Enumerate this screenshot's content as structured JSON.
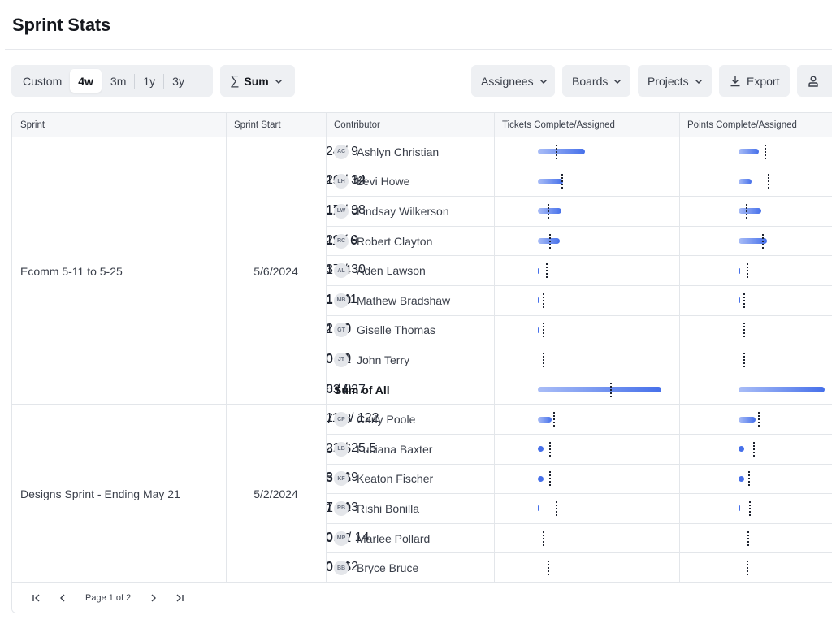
{
  "page": {
    "title": "Sprint Stats"
  },
  "toolbar": {
    "ranges": [
      {
        "label": "Custom",
        "active": false
      },
      {
        "label": "4w",
        "active": true
      },
      {
        "label": "3m",
        "active": false
      },
      {
        "label": "1y",
        "active": false
      },
      {
        "label": "3y",
        "active": false
      }
    ],
    "aggregate": {
      "symbol": "∑",
      "label": "Sum"
    },
    "filters": {
      "assignees": "Assignees",
      "boards": "Boards",
      "projects": "Projects"
    },
    "export_label": "Export"
  },
  "table": {
    "headers": {
      "sprint": "Sprint",
      "sprint_start": "Sprint Start",
      "contributor": "Contributor",
      "tickets": "Tickets Complete/Assigned",
      "points": "Points Complete/Assigned"
    },
    "groups": [
      {
        "sprint": "Ecomm 5-11 to 5-25",
        "start": "5/6/2024",
        "rows": [
          {
            "initials": "AC",
            "name": "Ashlyn Christian",
            "tickets": "24 / 9",
            "t_done": 24,
            "t_assigned": 9,
            "points": "26 / 34",
            "p_done": 26,
            "p_assigned": 34
          },
          {
            "initials": "LH",
            "name": "Levi Howe",
            "tickets": "13 / 12",
            "t_done": 13,
            "t_assigned": 12,
            "points": "17 / 38",
            "p_done": 17,
            "p_assigned": 38
          },
          {
            "initials": "LW",
            "name": "Lindsay Wilkerson",
            "tickets": "12 / 5",
            "t_done": 12,
            "t_assigned": 5,
            "points": "29 / 9",
            "p_done": 29,
            "p_assigned": 9
          },
          {
            "initials": "RC",
            "name": "Robert Clayton",
            "tickets": "11 / 6",
            "t_done": 11,
            "t_assigned": 6,
            "points": "37 / 30",
            "p_done": 37,
            "p_assigned": 30
          },
          {
            "initials": "AL",
            "name": "Aden Lawson",
            "tickets": "1 / 4",
            "t_done": 1,
            "t_assigned": 4,
            "points": "1 / 11",
            "p_done": 1,
            "p_assigned": 11
          },
          {
            "initials": "MB",
            "name": "Mathew Bradshaw",
            "tickets": "1 / 0",
            "t_done": 1,
            "t_assigned": 0,
            "points": "2 / 0",
            "p_done": 2,
            "p_assigned": 0
          },
          {
            "initials": "GT",
            "name": "Giselle Thomas",
            "tickets": "1 / 0",
            "t_done": 1,
            "t_assigned": 0,
            "points": "0 / 0",
            "p_done": 0,
            "p_assigned": 0
          },
          {
            "initials": "JT",
            "name": "John Terry",
            "tickets": "0 / 1",
            "t_done": 0,
            "t_assigned": 1,
            "points": "0 / 0",
            "p_done": 0,
            "p_assigned": 0
          },
          {
            "initials": "",
            "name": "Sum of All",
            "is_sum": true,
            "tickets": "63 / 37",
            "t_done": 63,
            "t_assigned": 37,
            "points": "112 / 122",
            "p_done": 112,
            "p_assigned": 122
          }
        ]
      },
      {
        "sprint": "Designs Sprint - Ending May 21",
        "start": "5/2/2024",
        "rows": [
          {
            "initials": "CP",
            "name": "Carly Poole",
            "tickets": "7 / 8",
            "t_done": 7,
            "t_assigned": 8,
            "points": "22 / 25.5",
            "p_done": 22,
            "p_assigned": 25.5
          },
          {
            "initials": "LB",
            "name": "Luciana Baxter",
            "tickets": "3 / 6",
            "t_done": 3,
            "t_assigned": 6,
            "points": "8 / 19",
            "p_done": 8,
            "p_assigned": 19
          },
          {
            "initials": "KF",
            "name": "Keaton Fischer",
            "tickets": "3 / 6",
            "t_done": 3,
            "t_assigned": 6,
            "points": "7 / 13",
            "p_done": 7,
            "p_assigned": 13
          },
          {
            "initials": "RB",
            "name": "Rishi Bonilla",
            "tickets": "1 / 9",
            "t_done": 1,
            "t_assigned": 9,
            "points": "0.5 / 14",
            "p_done": 0.5,
            "p_assigned": 14
          },
          {
            "initials": "MP",
            "name": "Marlee Pollard",
            "tickets": "0 / 2",
            "t_done": 0,
            "t_assigned": 2,
            "points": "0 / 12",
            "p_done": 0,
            "p_assigned": 12
          },
          {
            "initials": "BB",
            "name": "Bryce Bruce",
            "tickets": "0 / 5",
            "t_done": 0,
            "t_assigned": 5,
            "points": "0 / 10",
            "p_done": 0,
            "p_assigned": 10
          }
        ]
      }
    ]
  },
  "pagination": {
    "label": "Page 1 of 2"
  },
  "colors": {
    "accent": "#4670ea",
    "accent_light": "#a9bdf7",
    "border": "#e3e6ea",
    "header_bg": "#f6f7f9"
  }
}
